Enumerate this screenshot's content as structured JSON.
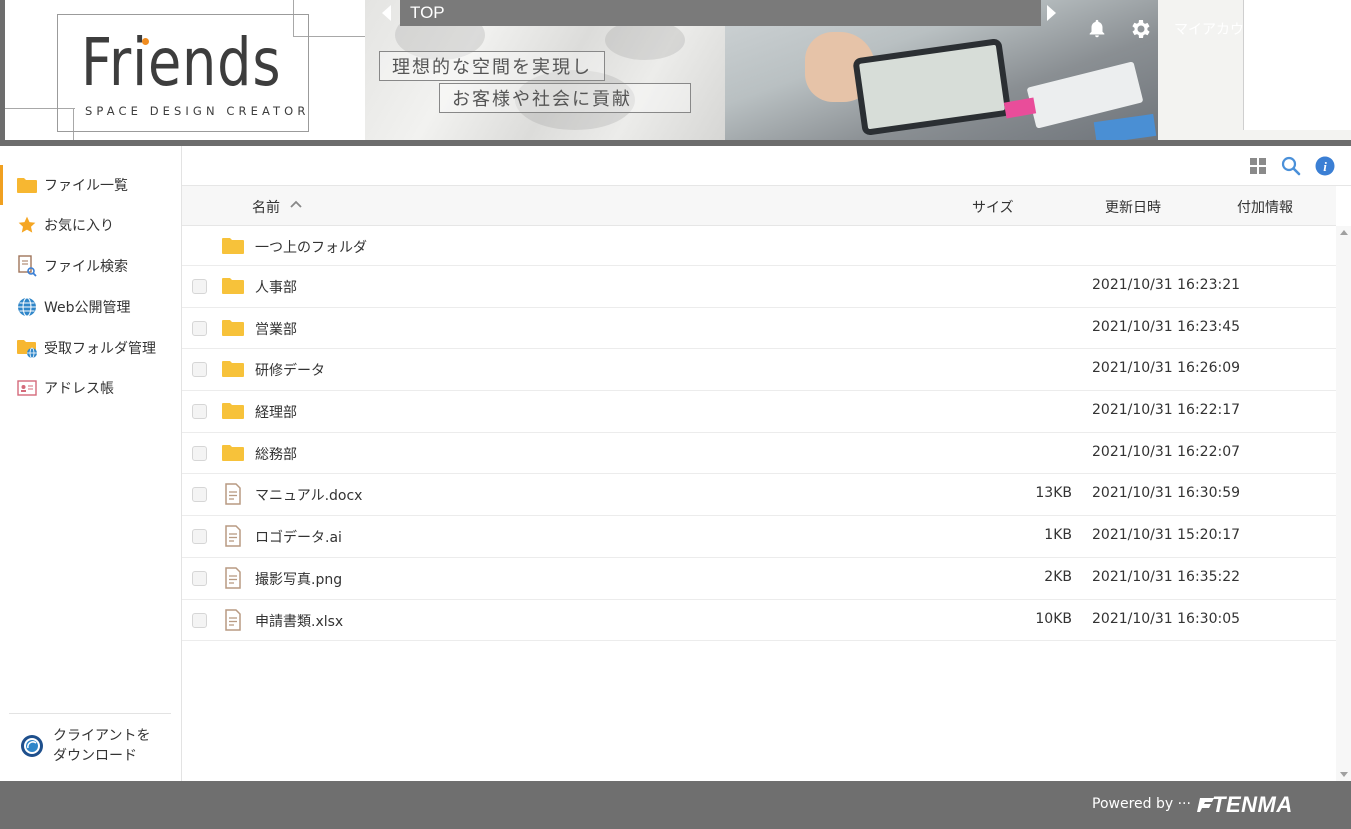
{
  "header": {
    "logo": "Friends",
    "logo_sub": "SPACE DESIGN CREATOR",
    "tagline_1": "理想的な空間を実現し",
    "tagline_2": "お客様や社会に貢献",
    "top_label": "TOP",
    "account_label": "マイアカウント"
  },
  "sidebar": {
    "items": [
      {
        "label": "ファイル一覧",
        "icon": "folder-icon",
        "active": true
      },
      {
        "label": "お気に入り",
        "icon": "star-icon"
      },
      {
        "label": "ファイル検索",
        "icon": "file-search-icon"
      },
      {
        "label": "Web公開管理",
        "icon": "globe-icon"
      },
      {
        "label": "受取フォルダ管理",
        "icon": "receive-folder-icon"
      },
      {
        "label": "アドレス帳",
        "icon": "address-book-icon"
      }
    ],
    "download_label_1": "クライアントを",
    "download_label_2": "ダウンロード"
  },
  "table": {
    "columns": {
      "name": "名前",
      "size": "サイズ",
      "updated": "更新日時",
      "extra": "付加情報"
    },
    "parent_folder": "一つ上のフォルダ",
    "rows": [
      {
        "type": "folder",
        "name": "人事部",
        "size": "",
        "updated": "2021/10/31 16:23:21"
      },
      {
        "type": "folder",
        "name": "営業部",
        "size": "",
        "updated": "2021/10/31 16:23:45"
      },
      {
        "type": "folder",
        "name": "研修データ",
        "size": "",
        "updated": "2021/10/31 16:26:09"
      },
      {
        "type": "folder",
        "name": "経理部",
        "size": "",
        "updated": "2021/10/31 16:22:17"
      },
      {
        "type": "folder",
        "name": "総務部",
        "size": "",
        "updated": "2021/10/31 16:22:07"
      },
      {
        "type": "file",
        "name": "マニュアル.docx",
        "size": "13KB",
        "updated": "2021/10/31 16:30:59"
      },
      {
        "type": "file",
        "name": "ロゴデータ.ai",
        "size": "1KB",
        "updated": "2021/10/31 15:20:17"
      },
      {
        "type": "file",
        "name": "撮影写真.png",
        "size": "2KB",
        "updated": "2021/10/31 16:35:22"
      },
      {
        "type": "file",
        "name": "申請書類.xlsx",
        "size": "10KB",
        "updated": "2021/10/31 16:30:05"
      }
    ]
  },
  "footer": {
    "powered_by": "Powered by ···",
    "brand": "TENMA"
  },
  "colors": {
    "accent": "#f0a020",
    "folder": "#f7c23a",
    "info": "#3b7fd4",
    "header_bg": "#6d6d6d",
    "footer_bg": "#6f6f6f"
  }
}
